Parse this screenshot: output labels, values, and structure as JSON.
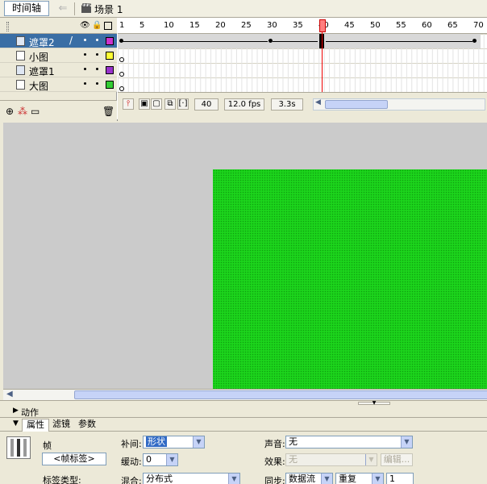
{
  "topbar": {
    "timeline_button": "时间轴",
    "back_arrow": "⇐",
    "scene_label": "场景 1"
  },
  "layers": [
    {
      "name": "遮罩2",
      "type": "mask",
      "selected": true,
      "color": "#cc33cc"
    },
    {
      "name": "小图",
      "type": "masked",
      "selected": false,
      "color": "#ffff33"
    },
    {
      "name": "遮罩1",
      "type": "mask",
      "selected": false,
      "color": "#9933cc"
    },
    {
      "name": "大图",
      "type": "masked",
      "selected": false,
      "color": "#33cc33"
    }
  ],
  "ruler": {
    "labels": [
      "1",
      "5",
      "10",
      "15",
      "20",
      "25",
      "30",
      "35",
      "40",
      "45",
      "50",
      "55",
      "60",
      "65",
      "70"
    ]
  },
  "status": {
    "current_frame": "40",
    "frame_rate": "12.0 fps",
    "elapsed": "3.3s"
  },
  "stage": {
    "shape_color": "#1cd41c"
  },
  "actions": {
    "label": "动作"
  },
  "panel": {
    "tabs": [
      "属性",
      "滤镜",
      "参数"
    ]
  },
  "props": {
    "frame_label": "帧",
    "frame_name_placeholder": "<帧标签>",
    "label_type": "标签类型:",
    "tween_label": "补间:",
    "tween_value": "形状",
    "ease_label": "缓动:",
    "ease_value": "0",
    "blend_label": "混合:",
    "blend_value": "分布式",
    "sound_label": "声音:",
    "sound_value": "无",
    "effect_label": "效果:",
    "effect_value": "无",
    "edit_button": "编辑...",
    "sync_label": "同步:",
    "sync_value": "数据流",
    "repeat_value": "重复",
    "repeat_count": "1"
  }
}
